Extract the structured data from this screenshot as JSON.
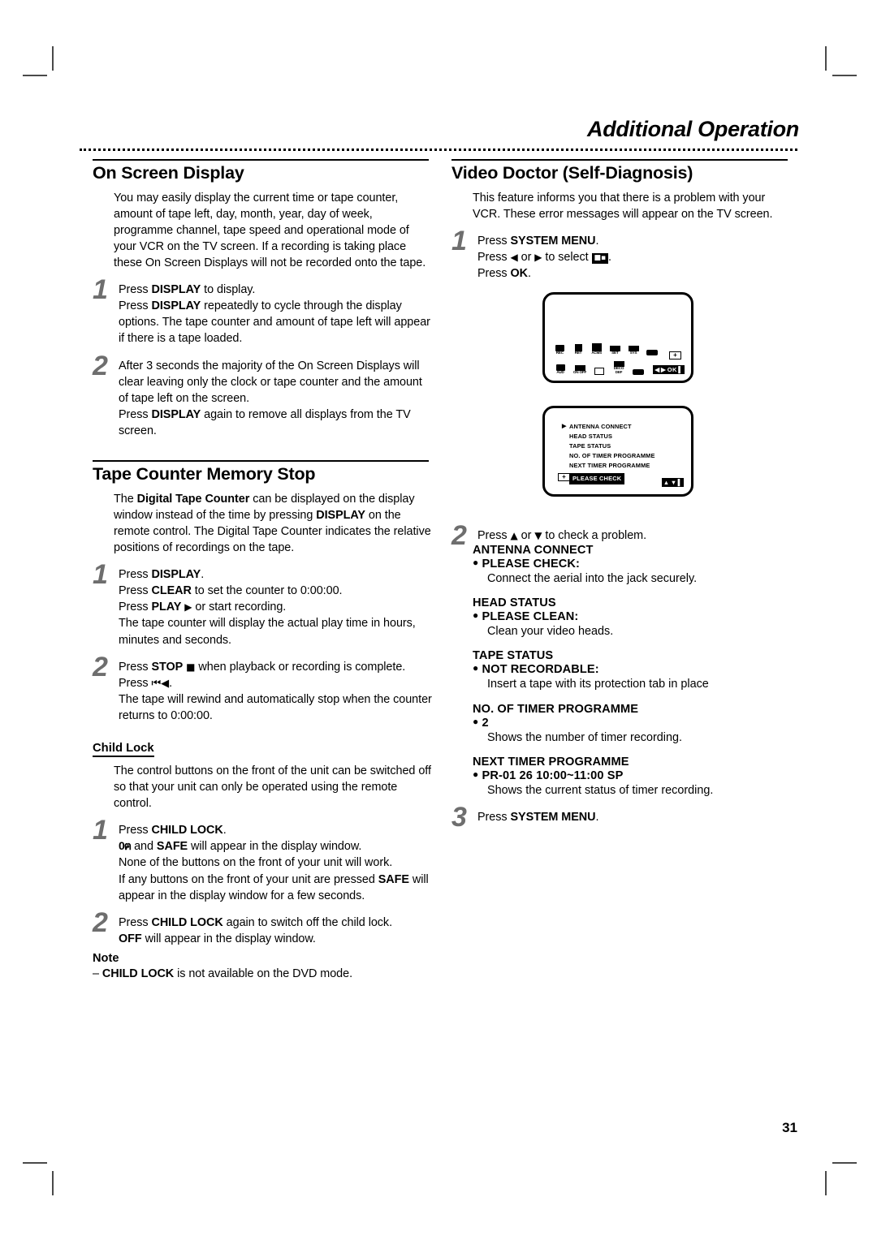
{
  "header": {
    "title": "Additional Operation",
    "page_number": "31"
  },
  "left_column": {
    "sections": [
      {
        "title": "On Screen Display",
        "intro": "You may easily display the current time or tape counter, amount of tape left, day, month, year, day of week, programme channel, tape speed and operational mode of your VCR on the TV screen. If a recording is taking place these On Screen Displays will not be recorded onto the tape.",
        "steps": [
          {
            "num": "1",
            "lines": [
              {
                "pre": "Press ",
                "bold": "DISPLAY",
                "post": " to display."
              },
              {
                "pre": "Press ",
                "bold": "DISPLAY",
                "post": " repeatedly to cycle through the display options. The tape counter and amount of tape left will appear if there is a tape loaded."
              }
            ]
          },
          {
            "num": "2",
            "lines": [
              {
                "pre": "After 3 seconds the majority of the On Screen Displays will clear leaving only the clock or tape counter and the amount of tape left on the screen.",
                "bold": "",
                "post": ""
              },
              {
                "pre": "Press ",
                "bold": "DISPLAY",
                "post": " again to remove all displays from the TV screen."
              }
            ]
          }
        ]
      },
      {
        "title": "Tape Counter Memory Stop",
        "intro_parts": {
          "a": "The ",
          "b1": "Digital Tape Counter",
          "c": " can be displayed on the display window instead of the time by pressing ",
          "b2": "DISPLAY",
          "d": " on the remote control. The Digital Tape Counter indicates the relative positions of recordings on the tape."
        },
        "steps": [
          {
            "num": "1",
            "l1_pre": "Press ",
            "l1_bold": "DISPLAY",
            "l1_post": ".",
            "l2_pre": "Press ",
            "l2_bold": "CLEAR",
            "l2_post": " to set the counter to 0:00:00.",
            "l3_pre": "Press ",
            "l3_bold": "PLAY",
            "l3_sym": "▶",
            "l3_post": " or start recording.",
            "l4": "The tape counter will display the actual play time in hours, minutes and seconds."
          },
          {
            "num": "2",
            "l1_pre": "Press ",
            "l1_bold": "STOP",
            "l1_sym": "■",
            "l1_post": " when playback or recording is complete.",
            "l2_pre": "Press ",
            "l2_sym": "⏮◀",
            "l2_post": ".",
            "l3": "The tape will rewind and automatically stop when the counter returns to 0:00:00."
          }
        ]
      }
    ],
    "child_lock": {
      "subhead": "Child Lock",
      "intro": "The control buttons on the front of the unit can be switched off so that your unit can only be operated using the remote control.",
      "steps": [
        {
          "num": "1",
          "l1_pre": "Press ",
          "l1_bold": "CHILD LOCK",
          "l1_post": ".",
          "l2_glyph": "0ฅ",
          "l2_mid": " and ",
          "l2_bold": "SAFE",
          "l2_post": " will appear in the display window.",
          "l3": "None of the  buttons on the front of your unit will work.",
          "l4_pre": "If any buttons on the front of your unit are pressed ",
          "l4_bold": "SAFE",
          "l4_post": " will appear in the display window for a few seconds."
        },
        {
          "num": "2",
          "l1_pre": "Press ",
          "l1_bold": "CHILD LOCK",
          "l1_post": " again to switch off the child lock.",
          "l2_bold": "OFF",
          "l2_post": " will appear in the display window."
        }
      ],
      "note_head": "Note",
      "note_dash": "–",
      "note_bold": "CHILD LOCK",
      "note_post": " is not available on the DVD mode."
    }
  },
  "right_column": {
    "section": {
      "title": "Video Doctor (Self-Diagnosis)",
      "intro": "This feature informs you that there is a problem with your VCR. These error messages will appear on the TV screen."
    },
    "step1": {
      "num": "1",
      "l1_pre": "Press ",
      "l1_bold": "SYSTEM MENU",
      "l1_post": ".",
      "l2_pre": "Press ",
      "l2_sym_left": "◀",
      "l2_mid": " or ",
      "l2_sym_right": "▶",
      "l2_post": " to select ",
      "l2_icon": "◧•",
      "l2_end": ".",
      "l3_pre": "Press ",
      "l3_bold": "OK",
      "l3_post": "."
    },
    "osd_screen": {
      "icons_row1": [
        {
          "label": "REC",
          "glyph": "rec-icon"
        },
        {
          "label": "RET",
          "glyph": "antenna-icon"
        },
        {
          "label": "ACMS",
          "glyph": "acms-icon"
        },
        {
          "label": "SET",
          "glyph": "set-icon"
        },
        {
          "label": "SYS",
          "glyph": "sys-icon"
        },
        {
          "label": "",
          "glyph": "plus-icon"
        }
      ],
      "icons_row2": [
        {
          "label": "AUD",
          "glyph": "audio-icon"
        },
        {
          "label": "ON OFF",
          "glyph": "onoff-icon"
        },
        {
          "label": "",
          "glyph": "cassette-icon"
        },
        {
          "label": "DECO DEF",
          "glyph": "deco-icon"
        },
        {
          "label": "",
          "glyph": "rec-badge-icon"
        }
      ],
      "plus_label": "+",
      "navbar": [
        "◀",
        "▶",
        "OK",
        "▌"
      ]
    },
    "menu_screen": {
      "cursor": "▶",
      "items": [
        "ANTENNA CONNECT",
        "HEAD STATUS",
        "TAPE STATUS",
        "NO. OF TIMER PROGRAMME",
        "NEXT TIMER PROGRAMME"
      ],
      "status": "PLEASE CHECK",
      "plus_label": "+",
      "navbar": [
        "▲",
        "▼",
        "▌"
      ]
    },
    "step2": {
      "num": "2",
      "lead_pre": "Press ",
      "lead_up": "▲",
      "lead_mid": " or ",
      "lead_down": "▼",
      "lead_post": " to check a problem.",
      "groups": [
        {
          "title": "ANTENNA CONNECT",
          "value": "PLEASE CHECK:",
          "desc": "Connect the aerial into the jack securely."
        },
        {
          "title": "HEAD STATUS",
          "value": "PLEASE CLEAN:",
          "desc": "Clean your video heads."
        },
        {
          "title": "TAPE STATUS",
          "value": "NOT RECORDABLE:",
          "desc": "Insert a tape with its protection tab in place"
        },
        {
          "title": "NO. OF TIMER PROGRAMME",
          "value": "2",
          "desc": "Shows the number of timer recording."
        },
        {
          "title": "NEXT TIMER PROGRAMME",
          "value": "PR-01 26 10:00~11:00 SP",
          "desc": "Shows the current status of timer recording."
        }
      ]
    },
    "step3": {
      "num": "3",
      "l1_pre": "Press ",
      "l1_bold": "SYSTEM MENU",
      "l1_post": "."
    }
  }
}
